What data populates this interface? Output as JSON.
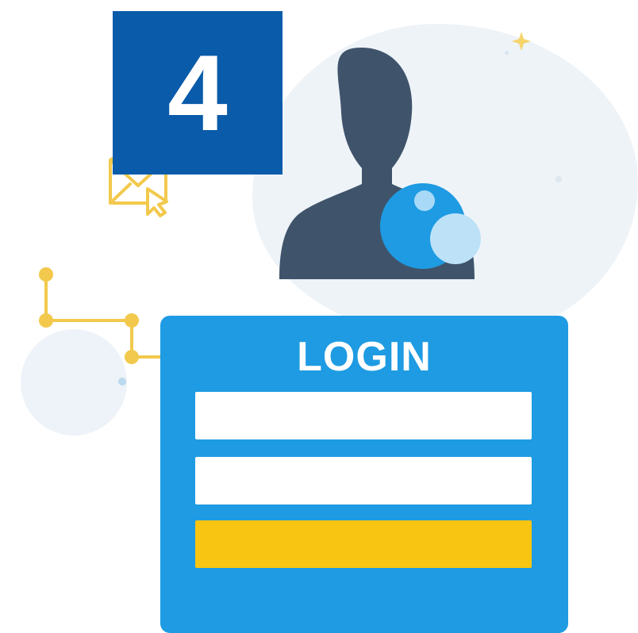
{
  "step_badge": {
    "number": "4",
    "color": "#0a5ba9"
  },
  "login_form": {
    "title": "LOGIN",
    "card_color": "#1e9be2",
    "button_color": "#f8c512"
  },
  "illustration": {
    "avatar_icon": "user-silhouette-icon",
    "avatar_color": "#3f546b",
    "badge_icon": "bubble-badge-icon",
    "mail_icon": "envelope-send-icon",
    "network_icon": "node-connector-icon",
    "sparkle_icon": "sparkle-icon",
    "accent_color": "#f2c94c"
  }
}
